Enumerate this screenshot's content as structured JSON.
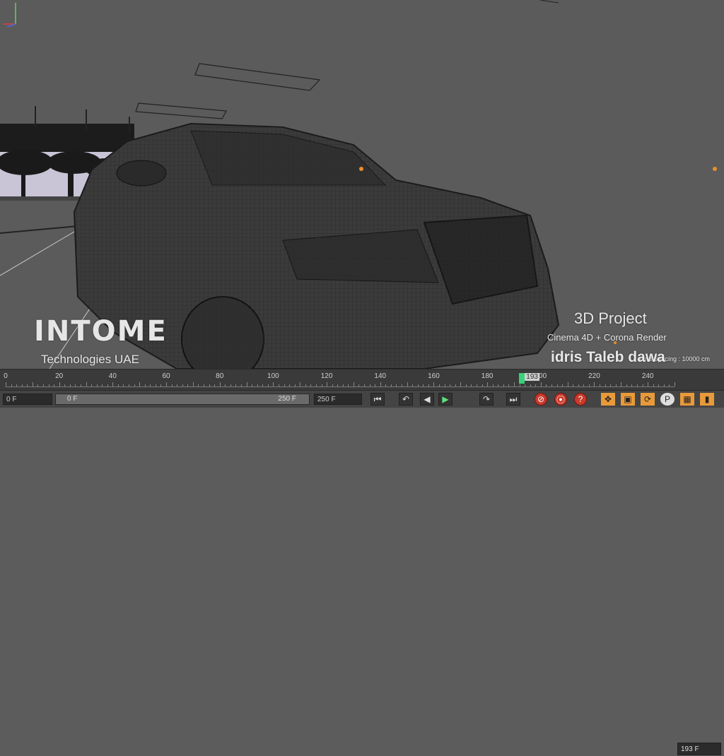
{
  "viewport": {
    "logo_text": "INTOME",
    "logo_subtitle": "Technologies UAE",
    "project_title": "3D Project",
    "project_subtitle": "Cinema 4D + Corona Render",
    "author": "idris Taleb dawa",
    "grid_spacing": "Grid Spacing : 10000 cm"
  },
  "timeline": {
    "ticks": [
      "0",
      "20",
      "40",
      "60",
      "80",
      "100",
      "120",
      "140",
      "160",
      "180",
      "200",
      "220",
      "240"
    ],
    "current_frame": 193,
    "playhead_label": "193",
    "current_frame_field": "193 F",
    "min": 0,
    "max": 250
  },
  "controls": {
    "start_field": "0 F",
    "range_start": "0 F",
    "range_end": "250 F",
    "end_field": "250 F",
    "buttons": [
      {
        "name": "go-to-start-icon",
        "glyph": "⏮"
      },
      {
        "name": "previous-key-icon",
        "glyph": "↶"
      },
      {
        "name": "previous-frame-icon",
        "glyph": "◀"
      },
      {
        "name": "play-forward-icon",
        "glyph": "▶"
      },
      {
        "name": "next-key-icon",
        "glyph": "↷"
      },
      {
        "name": "go-to-end-icon",
        "glyph": "⏭"
      }
    ],
    "record_buttons": [
      {
        "name": "record-active-objects-icon",
        "glyph": "⊘"
      },
      {
        "name": "autokeying-icon",
        "glyph": "⦿"
      },
      {
        "name": "keyframe-selection-icon",
        "glyph": "?"
      }
    ],
    "key_buttons": [
      {
        "name": "move-key-icon",
        "glyph": "✥"
      },
      {
        "name": "scale-key-icon",
        "glyph": "▣"
      },
      {
        "name": "rotate-key-icon",
        "glyph": "⟳"
      },
      {
        "name": "parameter-key-icon",
        "glyph": "P"
      },
      {
        "name": "point-level-icon",
        "glyph": "▦"
      },
      {
        "name": "more-icon",
        "glyph": "▮"
      }
    ]
  }
}
